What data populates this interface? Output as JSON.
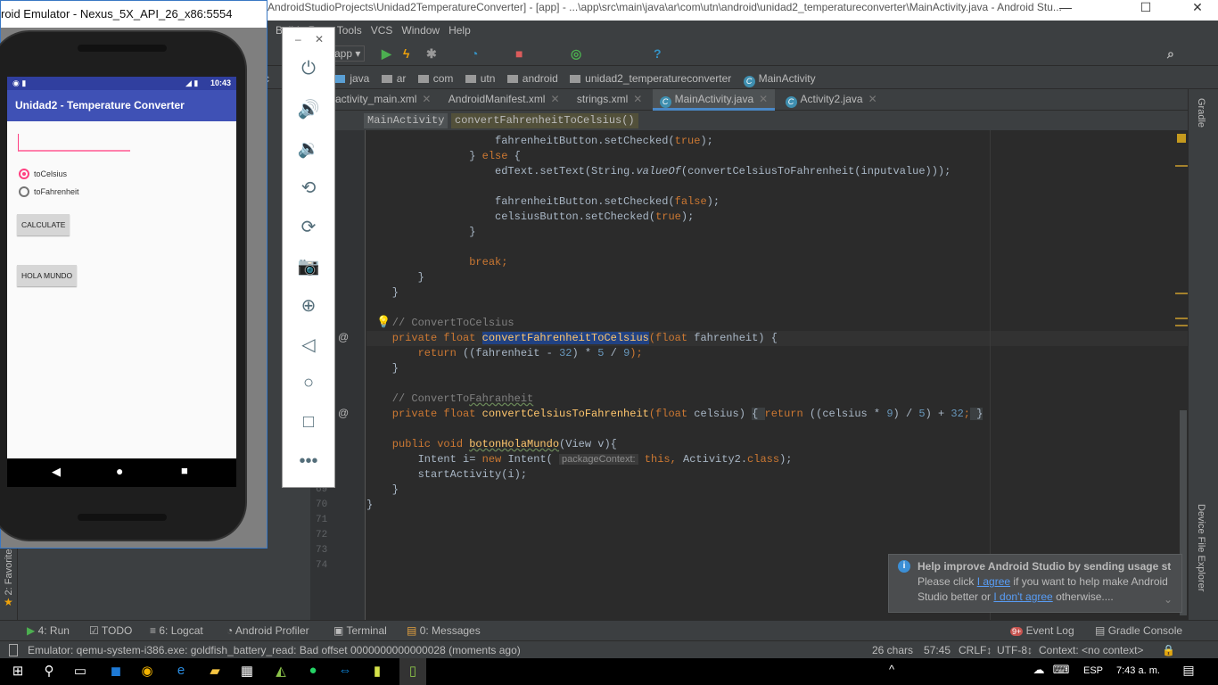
{
  "studio": {
    "title": "AndroidStudioProjects\\Unidad2TemperatureConverter] - [app] - ...\\app\\src\\main\\java\\ar\\com\\utn\\android\\unidad2_temperatureconverter\\MainActivity.java - Android Stu...",
    "menu": [
      "r",
      "Build",
      "Run",
      "Tools",
      "VCS",
      "Window",
      "Help"
    ],
    "run_config": "app",
    "breadcrumbs": [
      "c",
      "java",
      "ar",
      "com",
      "utn",
      "android",
      "unidad2_temperatureconverter",
      "MainActivity"
    ],
    "tabs": [
      {
        "label": "activity_main.xml",
        "active": false
      },
      {
        "label": "AndroidManifest.xml",
        "active": false
      },
      {
        "label": "strings.xml",
        "active": false
      },
      {
        "label": "MainActivity.java",
        "active": true
      },
      {
        "label": "Activity2.java",
        "active": false
      }
    ],
    "method_crumbs": [
      "MainActivity",
      "convertFahrenheitToCelsius()"
    ],
    "line_numbers": [
      "69",
      "70",
      "71",
      "72",
      "73",
      "74"
    ],
    "code": [
      [
        [
          "",
          "                    fahrenheitButton.setChecked("
        ],
        [
          "kw",
          "true"
        ],
        [
          "",
          ");"
        ]
      ],
      [
        [
          "",
          "                } "
        ],
        [
          "kw",
          "else"
        ],
        [
          "",
          " {"
        ]
      ],
      [
        [
          "",
          "                    edText.setText(String."
        ],
        [
          "it",
          "valueOf"
        ],
        [
          "",
          "(convertCelsiusToFahrenheit(inputvalue)));"
        ]
      ],
      [],
      [
        [
          "",
          "                    fahrenheitButton.setChecked("
        ],
        [
          "kw",
          "false"
        ],
        [
          "",
          ");"
        ]
      ],
      [
        [
          "",
          "                    celsiusButton.setChecked("
        ],
        [
          "kw",
          "true"
        ],
        [
          "",
          ");"
        ]
      ],
      [
        [
          "",
          "                }"
        ]
      ],
      [],
      [
        [
          "kw",
          "                break;"
        ]
      ],
      [
        [
          "",
          "        }"
        ]
      ],
      [
        [
          "",
          "    }"
        ]
      ],
      [],
      [
        [
          "cm",
          "    // ConvertToCelsius"
        ]
      ],
      [
        [
          "kw",
          "    private float "
        ],
        [
          "sel",
          "convertFahrenheitToCelsius"
        ],
        [
          "kw",
          "(float "
        ],
        [
          "",
          "fahrenheit) {"
        ]
      ],
      [
        [
          "kw",
          "        return "
        ],
        [
          "",
          "((fahrenheit - "
        ],
        [
          "num",
          "32"
        ],
        [
          "",
          ") * "
        ],
        [
          "num",
          "5"
        ],
        [
          "",
          " / "
        ],
        [
          "num",
          "9"
        ],
        [
          "kw",
          ");"
        ]
      ],
      [
        [
          "",
          "    }"
        ]
      ],
      [],
      [
        [
          "cm",
          "    // ConvertTo"
        ],
        [
          "cm uw",
          "Fahranheit"
        ]
      ],
      [
        [
          "kw",
          "    private float "
        ],
        [
          "fn",
          "convertCelsiusToFahrenheit"
        ],
        [
          "kw",
          "(float "
        ],
        [
          "",
          "celsius) "
        ],
        [
          "fold",
          "{ "
        ],
        [
          "kw",
          "return "
        ],
        [
          "",
          "((celsius * "
        ],
        [
          "num",
          "9"
        ],
        [
          "",
          ") / "
        ],
        [
          "num",
          "5"
        ],
        [
          "",
          ") + "
        ],
        [
          "num",
          "32"
        ],
        [
          "kw",
          ";"
        ],
        [
          "fold",
          " }"
        ]
      ],
      [],
      [
        [
          "kw",
          "    public void "
        ],
        [
          "fn uw",
          "botonHolaMundo"
        ],
        [
          "",
          "(View v){"
        ]
      ],
      [
        [
          "",
          "        Intent i= "
        ],
        [
          "kw",
          "new "
        ],
        [
          "",
          "Intent( "
        ],
        [
          "hint",
          "packageContext:"
        ],
        [
          "kw",
          " this, "
        ],
        [
          "",
          "Activity2."
        ],
        [
          "kw",
          "class"
        ],
        [
          "",
          ");"
        ]
      ],
      [
        [
          "",
          "        startActivity(i);"
        ]
      ],
      [
        [
          "",
          "    }"
        ]
      ],
      [
        [
          "",
          "}"
        ]
      ],
      [],
      [],
      [],
      []
    ],
    "right_tools": [
      "Gradle",
      "Device File Explorer"
    ],
    "left_tools": [
      "2: Favorites"
    ],
    "bottom_tools": [
      "4: Run",
      "TODO",
      "6: Logcat",
      "Android Profiler",
      "Terminal",
      "0: Messages"
    ],
    "event_log": "Event Log",
    "event_badge": "9+",
    "gradle_console": "Gradle Console",
    "status": {
      "message": "Emulator: qemu-system-i386.exe: goldfish_battery_read: Bad offset 0000000000000028 (moments ago)",
      "chars": "26 chars",
      "position": "57:45",
      "line_sep": "CRLF↕",
      "encoding": "UTF-8↕",
      "context": "Context: <no context>"
    },
    "notification": {
      "title": "Help improve Android Studio by sending usage st",
      "pre": "Please click ",
      "agree": "I agree",
      "mid": " if you want to help make Android Studio better or ",
      "disagree": "I don't agree",
      "post": " otherwise...."
    }
  },
  "emulator": {
    "title": "roid Emulator - Nexus_5X_API_26_x86:5554",
    "clock": "10:43",
    "app_title": "Unidad2 - Temperature Converter",
    "input_value": "",
    "radios": [
      {
        "label": "toCelsius",
        "checked": true
      },
      {
        "label": "toFahrenheit",
        "checked": false
      }
    ],
    "calculate": "CALCULATE",
    "hola": "HOLA MUNDO"
  },
  "taskbar": {
    "lang": "ESP",
    "time": "7:43 a. m."
  },
  "colors": {
    "keyword": "#cc7832",
    "number": "#6897bb",
    "comment": "#808080",
    "accent": "#ff4081",
    "primary": "#3f51b5"
  }
}
